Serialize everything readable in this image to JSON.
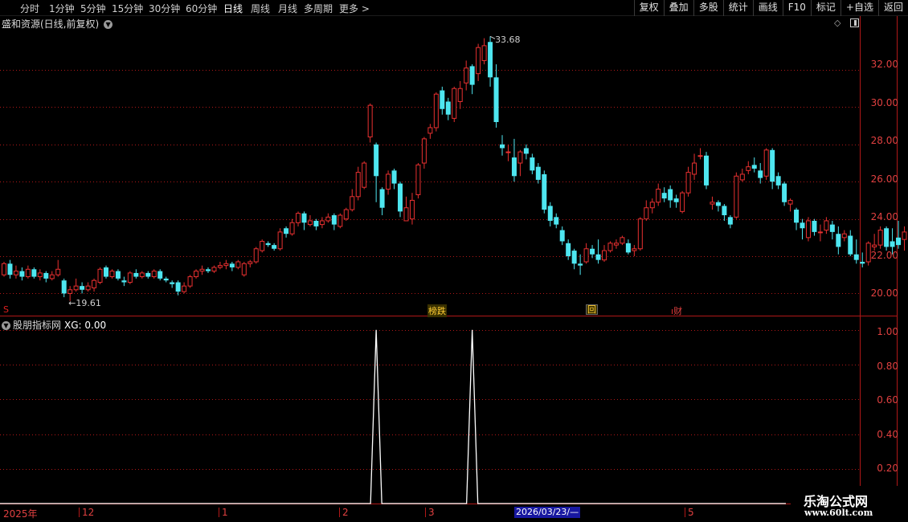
{
  "toolbar": {
    "periods": [
      "分时",
      "1分钟",
      "5分钟",
      "15分钟",
      "30分钟",
      "60分钟",
      "日线",
      "周线",
      "月线",
      "多周期",
      "更多"
    ],
    "more_arrow": ">",
    "active_period": "日线",
    "tools": [
      "复权",
      "叠加",
      "多股",
      "统计",
      "画线",
      "F10",
      "标记",
      "+自选",
      "返回"
    ]
  },
  "main_chart": {
    "title": "盛和资源(日线,前复权)",
    "high_label": "33.68",
    "low_label": "19.61",
    "y_labels": [
      "32.00",
      "30.00",
      "28.00",
      "26.00",
      "24.00",
      "22.00",
      "20.00"
    ],
    "markers": {
      "s": "S",
      "bangdie": "榜跌",
      "hui": "回",
      "caiwu": "财"
    }
  },
  "indicator": {
    "title": "股朋指标网",
    "xg_label": "XG: 0.00",
    "y_labels": [
      "1.00",
      "0.80",
      "0.60",
      "0.40",
      "0.20"
    ]
  },
  "date_axis": {
    "labels": [
      "2025年",
      "12",
      "1",
      "2",
      "3",
      "5"
    ],
    "cursor_date": "2026/03/23/—"
  },
  "watermark": {
    "logo": "乐淘公式网",
    "url": "www.60lt.com"
  },
  "colors": {
    "up": "#e83030",
    "down": "#4ee6f0",
    "grid": "#b01818",
    "ma_white": "#ffffff",
    "ma_yellow": "#ffd400"
  },
  "chart_data": [
    {
      "type": "candlestick",
      "title": "盛和资源(日线,前复权)",
      "ylim": [
        19.2,
        34.2
      ],
      "y_ticks": [
        20,
        22,
        24,
        26,
        28,
        30,
        32
      ],
      "max_label": 33.68,
      "min_label": 19.61,
      "candles": [
        [
          21.0,
          21.6,
          20.9,
          21.7
        ],
        [
          21.6,
          21.0,
          20.8,
          21.8
        ],
        [
          21.0,
          21.2,
          20.8,
          21.5
        ],
        [
          21.2,
          20.9,
          20.7,
          21.4
        ],
        [
          20.9,
          21.3,
          20.8,
          21.5
        ],
        [
          21.3,
          20.9,
          20.8,
          21.4
        ],
        [
          20.9,
          21.1,
          20.7,
          21.3
        ],
        [
          21.1,
          20.8,
          20.6,
          21.2
        ],
        [
          20.8,
          21.0,
          20.7,
          21.2
        ],
        [
          21.0,
          21.3,
          20.9,
          21.8
        ],
        [
          20.7,
          20.0,
          19.8,
          20.8
        ],
        [
          20.0,
          20.2,
          19.6,
          20.4
        ],
        [
          20.2,
          20.4,
          20.1,
          20.8
        ],
        [
          20.4,
          20.2,
          20.0,
          20.6
        ],
        [
          20.2,
          20.4,
          20.1,
          20.6
        ],
        [
          20.3,
          20.7,
          20.1,
          20.8
        ],
        [
          20.6,
          21.3,
          20.5,
          21.4
        ],
        [
          21.4,
          20.9,
          20.8,
          21.5
        ],
        [
          20.9,
          21.2,
          20.8,
          21.3
        ],
        [
          21.2,
          20.8,
          20.7,
          21.3
        ],
        [
          20.7,
          20.6,
          20.4,
          20.9
        ],
        [
          20.6,
          21.1,
          20.5,
          21.2
        ],
        [
          21.1,
          20.9,
          20.8,
          21.3
        ],
        [
          20.9,
          21.1,
          20.8,
          21.2
        ],
        [
          21.1,
          20.9,
          20.8,
          21.2
        ],
        [
          20.9,
          21.2,
          20.8,
          21.3
        ],
        [
          21.2,
          20.8,
          20.7,
          21.3
        ],
        [
          20.8,
          20.7,
          20.6,
          20.9
        ],
        [
          20.6,
          20.5,
          20.3,
          20.7
        ],
        [
          20.6,
          20.1,
          19.9,
          20.7
        ],
        [
          20.1,
          20.4,
          20.0,
          20.6
        ],
        [
          20.4,
          20.9,
          20.3,
          21.0
        ],
        [
          20.9,
          21.2,
          20.8,
          21.3
        ],
        [
          21.2,
          21.3,
          21.0,
          21.5
        ],
        [
          21.3,
          21.2,
          21.1,
          21.4
        ],
        [
          21.2,
          21.4,
          21.1,
          21.5
        ],
        [
          21.4,
          21.5,
          21.3,
          21.7
        ],
        [
          21.5,
          21.6,
          21.3,
          21.8
        ],
        [
          21.6,
          21.4,
          21.2,
          21.7
        ],
        [
          21.4,
          21.7,
          21.3,
          21.8
        ],
        [
          21.0,
          21.6,
          20.9,
          21.7
        ],
        [
          21.6,
          21.7,
          21.4,
          21.8
        ],
        [
          21.7,
          22.4,
          21.6,
          22.5
        ],
        [
          22.3,
          22.8,
          22.2,
          22.9
        ],
        [
          22.7,
          22.6,
          22.5,
          22.8
        ],
        [
          22.6,
          22.4,
          22.3,
          22.7
        ],
        [
          22.4,
          23.3,
          22.3,
          23.5
        ],
        [
          23.5,
          23.2,
          23.0,
          23.6
        ],
        [
          23.2,
          23.8,
          23.1,
          24.0
        ],
        [
          23.8,
          24.3,
          23.6,
          24.4
        ],
        [
          24.3,
          23.8,
          23.4,
          24.4
        ],
        [
          23.7,
          23.9,
          23.6,
          24.2
        ],
        [
          23.9,
          23.6,
          23.4,
          24.0
        ],
        [
          23.7,
          23.9,
          23.5,
          24.1
        ],
        [
          23.9,
          24.1,
          23.8,
          24.3
        ],
        [
          24.2,
          23.7,
          23.4,
          24.3
        ],
        [
          23.6,
          24.2,
          23.5,
          24.3
        ],
        [
          24.0,
          24.5,
          23.9,
          24.6
        ],
        [
          24.5,
          25.2,
          24.4,
          25.6
        ],
        [
          25.2,
          26.5,
          25.0,
          26.8
        ],
        [
          25.7,
          27.0,
          25.6,
          27.1
        ],
        [
          28.4,
          30.1,
          28.1,
          30.2
        ],
        [
          28.0,
          26.3,
          24.9,
          28.1
        ],
        [
          25.6,
          24.6,
          24.2,
          25.7
        ],
        [
          25.6,
          26.4,
          25.3,
          26.6
        ],
        [
          26.6,
          25.9,
          25.6,
          26.7
        ],
        [
          25.9,
          24.4,
          24.1,
          26.0
        ],
        [
          23.9,
          24.6,
          23.9,
          25.2
        ],
        [
          24.0,
          25.0,
          23.7,
          25.4
        ],
        [
          25.3,
          26.9,
          25.1,
          27.0
        ],
        [
          27.0,
          28.3,
          26.7,
          28.4
        ],
        [
          28.6,
          28.9,
          28.3,
          29.1
        ],
        [
          28.9,
          30.7,
          28.7,
          30.8
        ],
        [
          30.9,
          29.9,
          29.6,
          31.1
        ],
        [
          30.3,
          29.6,
          29.3,
          30.5
        ],
        [
          29.4,
          31.0,
          29.2,
          31.1
        ],
        [
          30.3,
          31.0,
          29.9,
          31.4
        ],
        [
          31.3,
          32.1,
          30.9,
          32.5
        ],
        [
          32.2,
          31.2,
          30.7,
          32.3
        ],
        [
          31.8,
          33.2,
          31.4,
          33.4
        ],
        [
          32.5,
          33.3,
          32.3,
          33.7
        ],
        [
          33.5,
          31.6,
          31.1,
          33.8
        ],
        [
          31.6,
          29.2,
          28.9,
          32.3
        ],
        [
          28.0,
          27.8,
          27.4,
          28.5
        ],
        [
          27.6,
          27.6,
          27.1,
          28.0
        ],
        [
          27.3,
          26.3,
          26.0,
          28.3
        ],
        [
          27.0,
          27.6,
          26.3,
          27.7
        ],
        [
          27.8,
          27.5,
          27.2,
          28.0
        ],
        [
          27.3,
          26.6,
          26.4,
          27.5
        ],
        [
          26.8,
          26.1,
          25.9,
          27.0
        ],
        [
          26.4,
          24.5,
          24.3,
          26.6
        ],
        [
          24.7,
          23.9,
          23.6,
          24.9
        ],
        [
          24.1,
          23.7,
          23.5,
          24.3
        ],
        [
          23.4,
          22.8,
          22.6,
          23.6
        ],
        [
          22.7,
          22.0,
          21.8,
          22.9
        ],
        [
          22.3,
          21.6,
          21.3,
          22.4
        ],
        [
          21.6,
          21.5,
          21.0,
          22.1
        ],
        [
          21.7,
          22.4,
          21.6,
          22.7
        ],
        [
          22.4,
          22.1,
          21.9,
          22.6
        ],
        [
          22.1,
          21.8,
          21.6,
          22.9
        ],
        [
          21.8,
          22.3,
          21.7,
          22.6
        ],
        [
          22.3,
          22.7,
          22.2,
          22.8
        ],
        [
          22.6,
          22.7,
          22.4,
          22.9
        ],
        [
          22.7,
          23.0,
          22.6,
          23.1
        ],
        [
          22.7,
          22.2,
          22.1,
          22.9
        ],
        [
          22.3,
          22.4,
          22.0,
          22.6
        ],
        [
          22.4,
          24.0,
          22.3,
          24.1
        ],
        [
          24.0,
          24.6,
          23.9,
          25.0
        ],
        [
          24.6,
          24.9,
          24.3,
          25.1
        ],
        [
          24.9,
          25.6,
          24.7,
          25.9
        ],
        [
          25.4,
          25.1,
          24.9,
          25.7
        ],
        [
          25.6,
          25.0,
          24.6,
          25.8
        ],
        [
          25.1,
          24.9,
          24.6,
          25.3
        ],
        [
          24.4,
          25.4,
          24.3,
          25.5
        ],
        [
          25.4,
          26.5,
          25.2,
          26.8
        ],
        [
          26.4,
          27.0,
          26.1,
          27.5
        ],
        [
          27.4,
          27.4,
          27.2,
          27.8
        ],
        [
          27.4,
          25.8,
          25.6,
          27.6
        ],
        [
          24.8,
          24.9,
          24.5,
          25.2
        ],
        [
          24.9,
          24.7,
          24.4,
          25.0
        ],
        [
          24.7,
          24.2,
          23.9,
          24.8
        ],
        [
          24.1,
          23.7,
          23.5,
          24.2
        ],
        [
          24.1,
          26.3,
          24.0,
          26.5
        ],
        [
          26.1,
          26.4,
          26.0,
          26.7
        ],
        [
          26.6,
          26.8,
          26.4,
          27.1
        ],
        [
          26.9,
          26.7,
          26.5,
          27.3
        ],
        [
          26.6,
          26.2,
          25.9,
          27.0
        ],
        [
          26.3,
          27.7,
          26.1,
          27.8
        ],
        [
          27.7,
          26.0,
          25.6,
          27.8
        ],
        [
          26.3,
          25.8,
          25.6,
          26.5
        ],
        [
          25.9,
          24.9,
          24.7,
          26.0
        ],
        [
          24.8,
          25.0,
          24.4,
          25.1
        ],
        [
          24.5,
          23.8,
          23.4,
          24.6
        ],
        [
          23.8,
          23.5,
          22.9,
          24.0
        ],
        [
          23.0,
          23.9,
          22.8,
          24.1
        ],
        [
          23.9,
          23.3,
          23.1,
          24.0
        ],
        [
          23.3,
          23.3,
          22.8,
          23.7
        ],
        [
          23.4,
          23.9,
          23.2,
          24.1
        ],
        [
          23.7,
          23.3,
          22.9,
          23.9
        ],
        [
          23.2,
          22.5,
          22.1,
          23.6
        ],
        [
          23.0,
          23.2,
          22.8,
          23.4
        ],
        [
          23.1,
          22.1,
          22.0,
          23.4
        ],
        [
          22.1,
          21.8,
          21.6,
          22.9
        ],
        [
          21.7,
          21.6,
          21.4,
          22.2
        ],
        [
          21.7,
          22.7,
          21.5,
          22.8
        ],
        [
          22.5,
          22.6,
          22.3,
          23.2
        ],
        [
          22.6,
          23.4,
          22.4,
          23.6
        ],
        [
          23.5,
          22.5,
          22.3,
          23.6
        ],
        [
          22.8,
          22.5,
          22.1,
          23.5
        ],
        [
          23.0,
          22.6,
          22.4,
          23.9
        ],
        [
          22.9,
          23.3,
          22.3,
          23.6
        ],
        [
          23.3,
          24.1,
          23.2,
          24.9
        ]
      ]
    },
    {
      "type": "line",
      "title": "股朋指标网",
      "series": [
        {
          "name": "XG",
          "spike_candle_indices": [
            62,
            78
          ],
          "spike_value": 1.0,
          "base_value": 0.0
        }
      ],
      "ylim": [
        0,
        1.05
      ],
      "y_ticks": [
        0.2,
        0.4,
        0.6,
        0.8,
        1.0
      ]
    }
  ]
}
